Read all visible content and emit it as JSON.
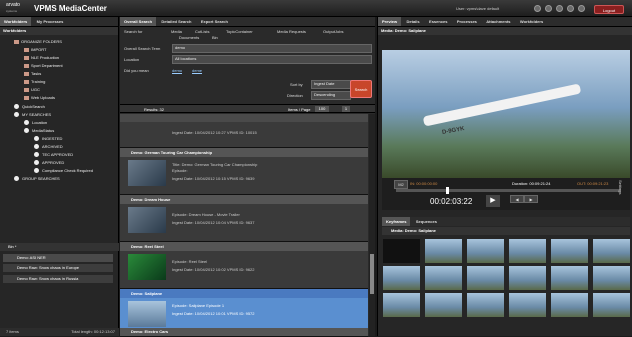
{
  "app": {
    "logo": "arvato",
    "logo_sub": "systems",
    "title": "VPMS MediaCenter"
  },
  "header": {
    "user": "User: vpms\\dave default",
    "logout": "Logout"
  },
  "left_tabs": [
    "Workfolders",
    "My Processes"
  ],
  "left": {
    "workfolders_title": "Workfolders",
    "tree": [
      "ORGANIZE FOLDERS",
      "IMPORT",
      "NLE Production",
      "Sport Department",
      "Tasks",
      "Training",
      "UGC",
      "Web Uploads",
      "QuickSearch",
      "MY SEARCHES",
      "Location",
      "MediaStatus",
      "INGESTED",
      "ARCHIVED",
      "TEC APPROVED",
      "APPROVED",
      "Compliance Check Required",
      "GROUP SEARCHES"
    ],
    "bin_title": "Bin *",
    "bin_items": [
      "Demo: ASI NER",
      "Demo Raw: Snow chaos in Europe",
      "Demo Raw: Snow chaos in Russia"
    ],
    "footer_items": "7 items",
    "footer_length": "Total length: 00:12:13:07"
  },
  "center_tabs": [
    "Overall Search",
    "Detailed Search",
    "Export Search"
  ],
  "search": {
    "search_for_label": "Search for",
    "options": [
      "Media",
      "CutLists",
      "TopicContainer",
      "Media Requests",
      "OutputJobs",
      "Documents",
      "Bin"
    ],
    "term_label": "Overall Search Term",
    "term_value": "demo",
    "location_label": "Location",
    "location_value": "All locations",
    "didyoumean_label": "Did you mean",
    "suggestions": [
      "demo",
      "deme"
    ],
    "sortby_label": "Sort by",
    "sortby_value": "Ingest Date",
    "direction_label": "Direction",
    "direction_value": "Descending",
    "search_button": "Search"
  },
  "results_bar": {
    "results": "Results: 32",
    "items_per_page": "Items / Page",
    "per_page_value": "100",
    "page": "1"
  },
  "results": [
    {
      "title": "",
      "meta1": "Ingest Date: 10/04/2012 10:27 VPMS ID: 10015",
      "meta2": ""
    },
    {
      "title": "Demo: German Touring Car Championship",
      "meta1": "Title: Demo: German Touring Car Championship",
      "meta2": "Episode:",
      "meta3": "Ingest Date: 10/04/2012 10:15 VPMS ID: 9639"
    },
    {
      "title": "Demo: Dream House",
      "meta1": "Episode: Dream House - Movie Trailer",
      "meta2": "Ingest Date: 10/04/2012 10:04 VPMS ID: 9637"
    },
    {
      "title": "Demo: Reel Steel",
      "meta1": "Episode: Reel Steel",
      "meta2": "Ingest Date: 10/04/2012 10:02 VPMS ID: 9622"
    },
    {
      "title": "Demo: Sailplane",
      "meta1": "Episode: Sailplane Episode 1",
      "meta2": "Ingest Date: 10/04/2012 10:01 VPMS ID: 9572"
    },
    {
      "title": "Demo: Electro Cars",
      "meta1": "Title: Demo: Electro Cars",
      "meta2": ""
    }
  ],
  "right_tabs": [
    "Preview",
    "Details",
    "Essences",
    "Processes",
    "Attachments",
    "Workfolders"
  ],
  "preview": {
    "title": "Media: Demo: Sailplane",
    "timecode_in": "IN: 00:00:00:00",
    "duration": "Duration: 00:09:21:24",
    "timecode_out": "OUT: 00:09:21:23",
    "current_time": "00:02:03:22",
    "m2": "M2",
    "settings": "Settings",
    "plane_label": "D-9GYK"
  },
  "keyframe_tabs": [
    "Keyframes",
    "Sequences"
  ],
  "keyframes_title": "Media: Demo: Sailplane",
  "colors": {
    "accent": "#c8462a",
    "selected": "#2a6fc0",
    "background": "#1b1b1b"
  }
}
